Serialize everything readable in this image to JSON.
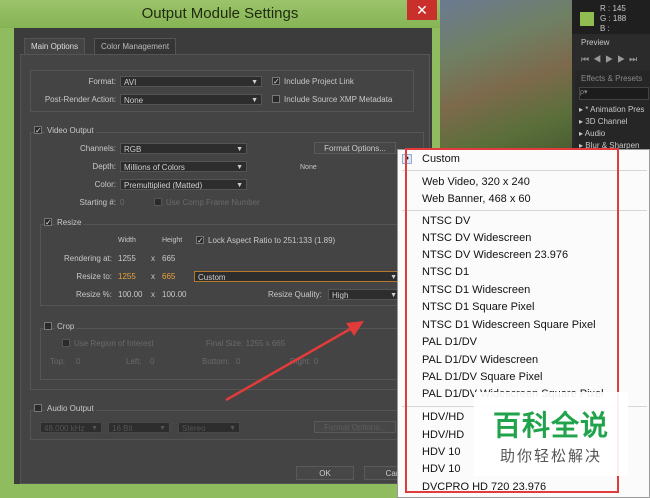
{
  "window": {
    "title": "Output Module Settings",
    "close_glyph": "✕"
  },
  "tabs": [
    {
      "label": "Main Options"
    },
    {
      "label": "Color Management"
    }
  ],
  "main": {
    "format_label": "Format:",
    "format_value": "AVI",
    "post_render_label": "Post-Render Action:",
    "post_render_value": "None",
    "include_project_link": "Include Project Link",
    "include_xmp": "Include Source XMP Metadata"
  },
  "video": {
    "section_label": "Video Output",
    "channels_label": "Channels:",
    "channels_value": "RGB",
    "depth_label": "Depth:",
    "depth_value": "Millions of Colors",
    "color_label": "Color:",
    "color_value": "Premultiplied (Matted)",
    "format_options": "Format Options...",
    "codec_value": "None",
    "starting_label": "Starting #:",
    "starting_value": "0",
    "use_comp_frame": "Use Comp Frame Number"
  },
  "resize": {
    "section_label": "Resize",
    "width_header": "Width",
    "height_header": "Height",
    "lock_aspect": "Lock Aspect Ratio to 251:133 (1.89)",
    "rendering_label": "Rendering at:",
    "rendering_w": "1255",
    "rendering_h": "665",
    "resize_to_label": "Resize to:",
    "resize_to_w": "1255",
    "resize_to_h": "665",
    "preset_value": "Custom",
    "resize_pct_label": "Resize %:",
    "resize_pct_w": "100.00",
    "resize_pct_h": "100.00",
    "quality_label": "Resize Quality:",
    "quality_value": "High",
    "x_glyph": "x"
  },
  "crop": {
    "section_label": "Crop",
    "use_roi": "Use Region of Interest",
    "final_size": "Final Size: 1255 x 665",
    "top_label": "Top:",
    "top_value": "0",
    "left_label": "Left:",
    "left_value": "0",
    "bottom_label": "Bottom:",
    "bottom_value": "0",
    "right_label": "Right:",
    "right_value": "0"
  },
  "audio": {
    "section_label": "Audio Output",
    "rate_value": "48.000 kHz",
    "bits_value": "16 Bit",
    "channels_value": "Stereo",
    "format_options": "Format Options..."
  },
  "buttons": {
    "ok": "OK",
    "cancel": "Can"
  },
  "info_panel": {
    "r": "R : 145",
    "g": "G : 188",
    "b": "B :"
  },
  "preview_panel": {
    "tab": "Preview"
  },
  "effects_panel": {
    "title": "Effects & Presets",
    "search_placeholder": "ρ▾",
    "items": [
      "* Animation Pres",
      "3D Channel",
      "Audio",
      "Blur & Sharpen"
    ]
  },
  "dropdown": {
    "selected": "Custom",
    "group1": [
      "Web Video, 320 x 240",
      "Web Banner, 468 x 60"
    ],
    "group2": [
      "NTSC DV",
      "NTSC DV Widescreen",
      "NTSC DV Widescreen 23.976",
      "NTSC D1",
      "NTSC D1 Widescreen",
      "NTSC D1 Square Pixel",
      "NTSC D1 Widescreen Square Pixel",
      "PAL D1/DV",
      "PAL D1/DV Widescreen",
      "PAL D1/DV Square Pixel",
      "PAL D1/DV Widescreen Square Pixel"
    ],
    "group3": [
      "HDV/HD",
      "HDV/HD",
      "HDV 10",
      "HDV 10",
      "DVCPRO HD 720 23.976"
    ]
  },
  "watermark": {
    "title": "百科全说",
    "subtitle": "助你轻松解决"
  },
  "colors": {
    "highlight_red": "#e23b3b",
    "window_green": "#8fbc5e",
    "watermark_green": "#20a34a",
    "value_orange": "#e8a23a"
  }
}
